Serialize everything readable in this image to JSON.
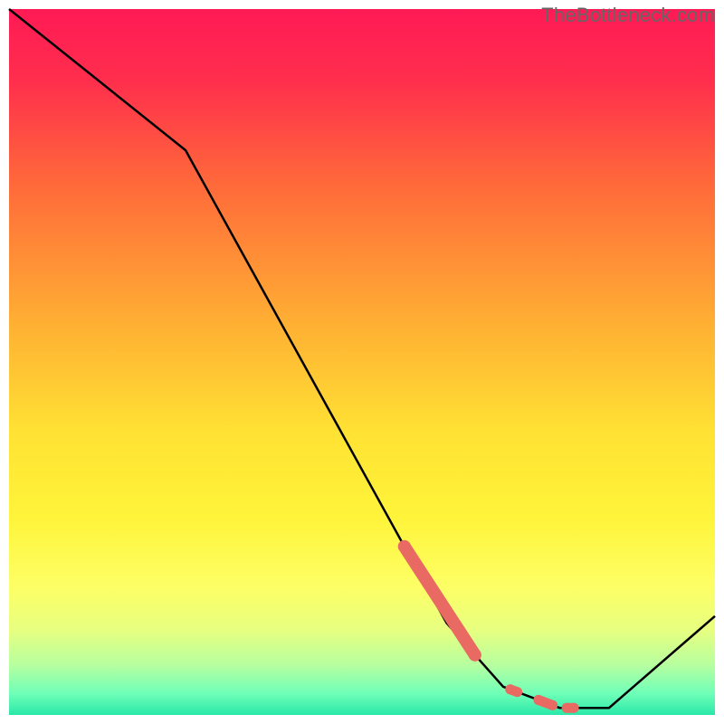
{
  "watermark": "TheBottleneck.com",
  "chart_data": {
    "type": "line",
    "title": "",
    "xlabel": "",
    "ylabel": "",
    "xlim": [
      0,
      100
    ],
    "ylim": [
      0,
      100
    ],
    "x": [
      0,
      25,
      62,
      70,
      78,
      85,
      100
    ],
    "y": [
      100,
      80,
      13,
      4,
      1,
      1,
      14
    ],
    "highlight_segments": [
      {
        "x_start": 56,
        "x_end": 66,
        "thick": true
      },
      {
        "x_start": 71,
        "x_end": 72,
        "thick": false
      },
      {
        "x_start": 75,
        "x_end": 77,
        "thick": false
      },
      {
        "x_start": 79,
        "x_end": 80,
        "thick": false
      }
    ],
    "gradient_stops": [
      {
        "offset": 0.0,
        "color": "#ff1a55"
      },
      {
        "offset": 0.1,
        "color": "#ff2e4d"
      },
      {
        "offset": 0.25,
        "color": "#ff6a3a"
      },
      {
        "offset": 0.45,
        "color": "#ffb133"
      },
      {
        "offset": 0.6,
        "color": "#ffe233"
      },
      {
        "offset": 0.72,
        "color": "#fff43a"
      },
      {
        "offset": 0.82,
        "color": "#fdff66"
      },
      {
        "offset": 0.88,
        "color": "#e7ff80"
      },
      {
        "offset": 0.93,
        "color": "#b6ffa0"
      },
      {
        "offset": 0.97,
        "color": "#6effb8"
      },
      {
        "offset": 1.0,
        "color": "#2ae8a8"
      }
    ],
    "highlight_color": "#e86a63",
    "line_color": "#000000",
    "border_color": "#ffffff"
  }
}
